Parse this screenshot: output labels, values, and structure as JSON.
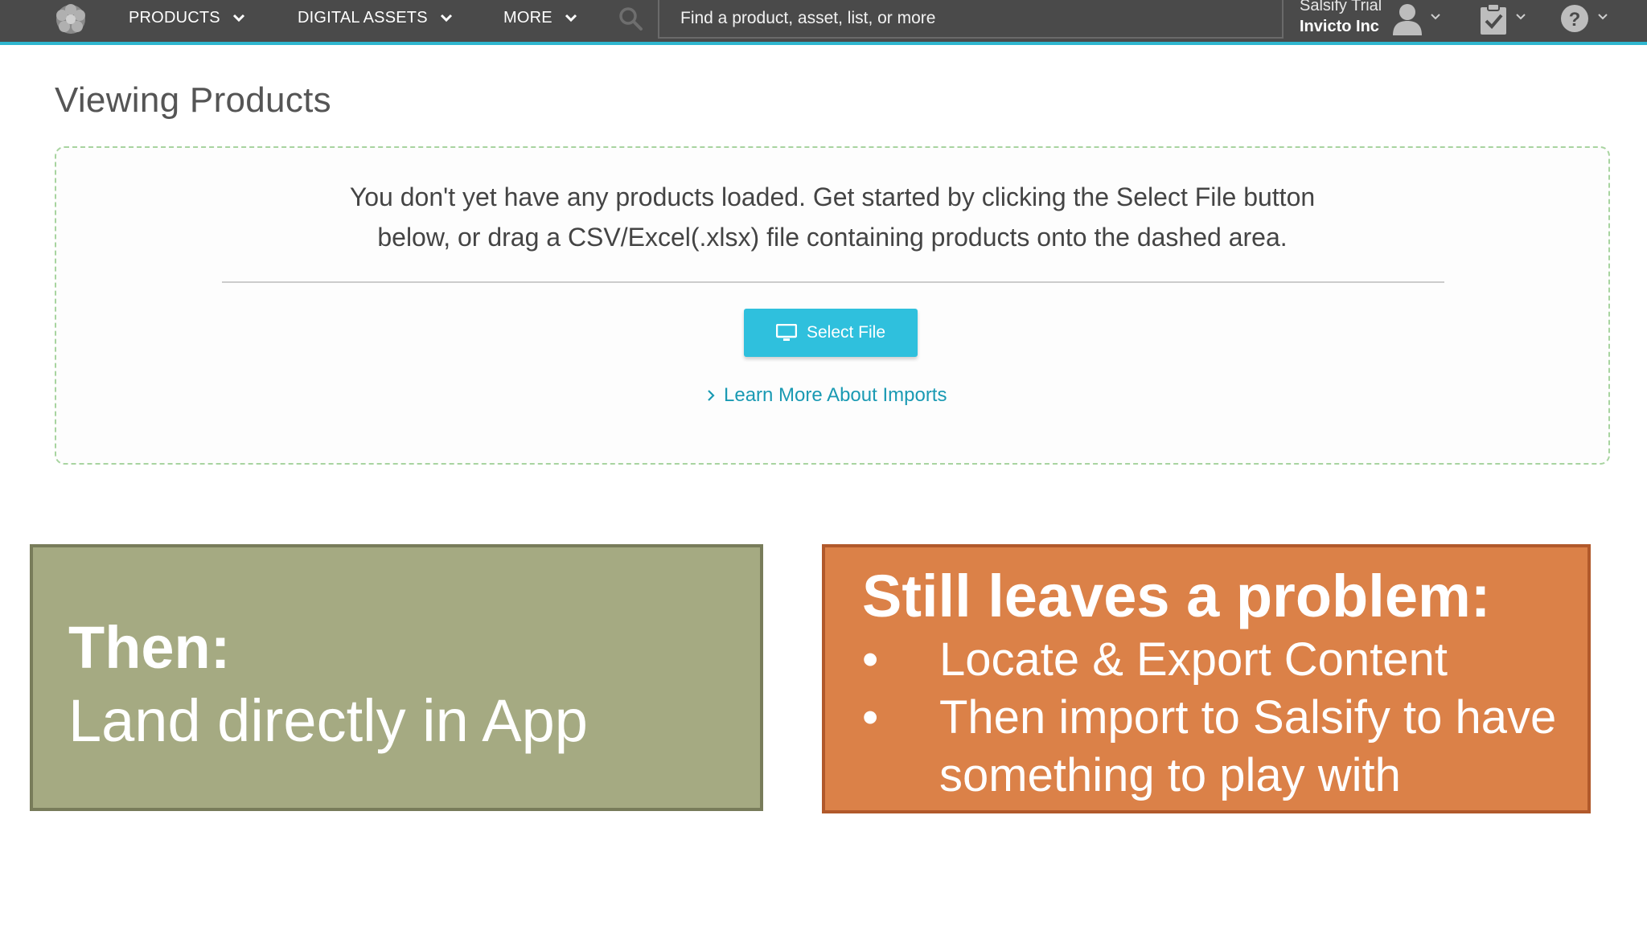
{
  "nav": {
    "products": "PRODUCTS",
    "digital_assets": "DIGITAL ASSETS",
    "more": "MORE",
    "search_placeholder": "Find a product, asset, list, or more"
  },
  "account": {
    "trial_label": "Salsify Trial",
    "company": "Invicto Inc"
  },
  "page": {
    "title": "Viewing Products",
    "empty_line1": "You don't yet have any products loaded. Get started by clicking the Select File button",
    "empty_line2": "below, or drag a CSV/Excel(.xlsx) file containing products onto the dashed area.",
    "select_file_label": "Select File",
    "learn_more_label": "Learn More About Imports"
  },
  "callouts": {
    "left": {
      "heading": "Then:",
      "body": "Land directly in App"
    },
    "right": {
      "heading": "Still leaves a problem:",
      "bullet_char": "•",
      "bullets": [
        "Locate & Export Content",
        "Then import to Salsify to have something to play with"
      ]
    }
  },
  "colors": {
    "nav_background": "#4a4a4a",
    "accent_teal": "#2fc0dd",
    "link": "#1a9ab3",
    "callout_green": "#a5aa82",
    "callout_orange": "#db8148"
  },
  "icons": {
    "logo": "salsify-logo-icon",
    "search": "search-icon",
    "user": "user-icon",
    "tasks": "clipboard-check-icon",
    "help": "help-icon",
    "button": "monitor-icon"
  }
}
